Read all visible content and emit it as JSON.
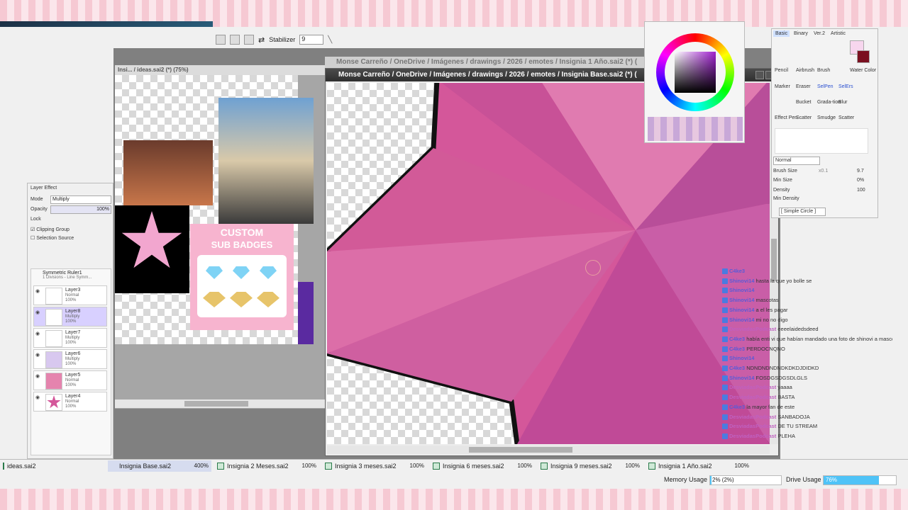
{
  "toolbar": {
    "stabilizer_label": "Stabilizer",
    "stabilizer_value": "9"
  },
  "left_window": {
    "title": "Insi... / ideas.sai2 (*) (75%)",
    "badge_title_line1": "CUSTOM",
    "badge_title_line2": "SUB BADGES"
  },
  "main_window": {
    "title": "Monse Carreño / OneDrive / Imágenes / drawings / 2026 / emotes / Insignia Base.sai2 (*) (",
    "back_title": "Monse Carreño / OneDrive / Imágenes / drawings / 2026 / emotes / Insignia 1 Año.sai2 (*) ("
  },
  "layer_effect": {
    "title": "Layer Effect",
    "mode_label": "Mode",
    "mode_value": "Multiply",
    "opacity_label": "Opacity",
    "opacity_value": "100%",
    "lock_label": "Lock",
    "clipping_group": "Clipping Group",
    "selection_source": "Selection Source",
    "ruler_name": "Symmetric Ruler1",
    "ruler_desc": "1 Divisions - Line Symm...",
    "layers": [
      {
        "name": "Layer3",
        "mode": "Normal",
        "opacity": "100%"
      },
      {
        "name": "Layer8",
        "mode": "Multiply",
        "opacity": "100%"
      },
      {
        "name": "Layer7",
        "mode": "Multiply",
        "opacity": "100%"
      },
      {
        "name": "Layer6",
        "mode": "Multiply",
        "opacity": "100%"
      },
      {
        "name": "Layer5",
        "mode": "Normal",
        "opacity": "100%"
      },
      {
        "name": "Layer4",
        "mode": "Normal",
        "opacity": "100%"
      }
    ]
  },
  "tool_panel": {
    "tabs": [
      "Basic",
      "Binary",
      "Ver.2",
      "Artistic"
    ],
    "tools": [
      "Pencil",
      "Airbrush",
      "Brush",
      "Water Color",
      "Marker",
      "Eraser",
      "SelPen",
      "SelErs",
      "Bucket",
      "Grada-tion",
      "Blur",
      "Effect Pen",
      "Scatter",
      "Smudge",
      "Scatter"
    ],
    "blend_mode": "Normal",
    "brush_size_label": "Brush Size",
    "brush_size_mult": "x0.1",
    "brush_size_value": "9.7",
    "min_size_label": "Min Size",
    "min_size_value": "0%",
    "density_label": "Density",
    "density_value": "100",
    "min_density_label": "Min Density",
    "shape": "[ Simple Circle ]"
  },
  "chat": [
    {
      "name": "C4ke3",
      "msg": "",
      "color": "#5b5bd6"
    },
    {
      "name": "Shinovi14",
      "msg": "hasta la que yo bolle se",
      "color": "#5b5bd6"
    },
    {
      "name": "Shinovi14",
      "msg": "",
      "color": "#5b5bd6"
    },
    {
      "name": "Shinovi14",
      "msg": "mascotas",
      "color": "#5b5bd6"
    },
    {
      "name": "Shinovi14",
      "msg": "a el les pagar",
      "color": "#5b5bd6"
    },
    {
      "name": "Shinovi14",
      "msg": "mi no no digo",
      "color": "#5b5bd6"
    },
    {
      "name": "DesviadasPodcast",
      "msg": "eeeelaidedsdeed",
      "color": "#c060c0"
    },
    {
      "name": "C4ke3",
      "msg": "había enti vi que habían mandado una foto de shinovi a mascotas",
      "color": "#5b5bd6"
    },
    {
      "name": "C4ke3",
      "msg": "PERDOCNQNO",
      "color": "#5b5bd6"
    },
    {
      "name": "Shinovi14",
      "msg": "",
      "color": "#5b5bd6"
    },
    {
      "name": "C4ke3",
      "msg": "NDNDNDNDNDKDKDJDIDKD",
      "color": "#5b5bd6"
    },
    {
      "name": "Shinovi14",
      "msg": "FOSDGSDGSDLGLS",
      "color": "#5b5bd6"
    },
    {
      "name": "DesviadasPodcast",
      "msg": "yaaaa",
      "color": "#c060c0"
    },
    {
      "name": "DesviadasPodcast",
      "msg": "BASTA",
      "color": "#c060c0"
    },
    {
      "name": "C4ke3",
      "msg": "la mayor fan de este",
      "color": "#5b5bd6"
    },
    {
      "name": "DesviadasPodcast",
      "msg": "SANBADOJA",
      "color": "#c060c0"
    },
    {
      "name": "DesviadasPodcast",
      "msg": "DE TU STREAM",
      "color": "#c060c0"
    },
    {
      "name": "DesviadasPodcast",
      "msg": "PLEHA",
      "color": "#c060c0"
    }
  ],
  "tabs": [
    {
      "name": "ideas.sai2",
      "zoom": ""
    },
    {
      "name": "Insignia Base.sai2",
      "zoom": "400%"
    },
    {
      "name": "Insignia 2 Meses.sai2",
      "zoom": "100%"
    },
    {
      "name": "Insignia 3 meses.sai2",
      "zoom": "100%"
    },
    {
      "name": "Insignia 6 meses.sai2",
      "zoom": "100%"
    },
    {
      "name": "Insignia 9 meses.sai2",
      "zoom": "100%"
    },
    {
      "name": "Insignia 1 Año.sai2",
      "zoom": "100%"
    }
  ],
  "status": {
    "memory_label": "Memory Usage",
    "memory_value": "2% (2%)",
    "memory_fraction": 0.02,
    "drive_label": "Drive Usage",
    "drive_value": "76%",
    "drive_fraction": 0.76
  },
  "colors": {
    "accent_blue": "#4fc3f7",
    "active_tab": "#d6dcef",
    "pink": "#d9528f",
    "magenta": "#a84a8f",
    "current_color": "#7a1020"
  }
}
